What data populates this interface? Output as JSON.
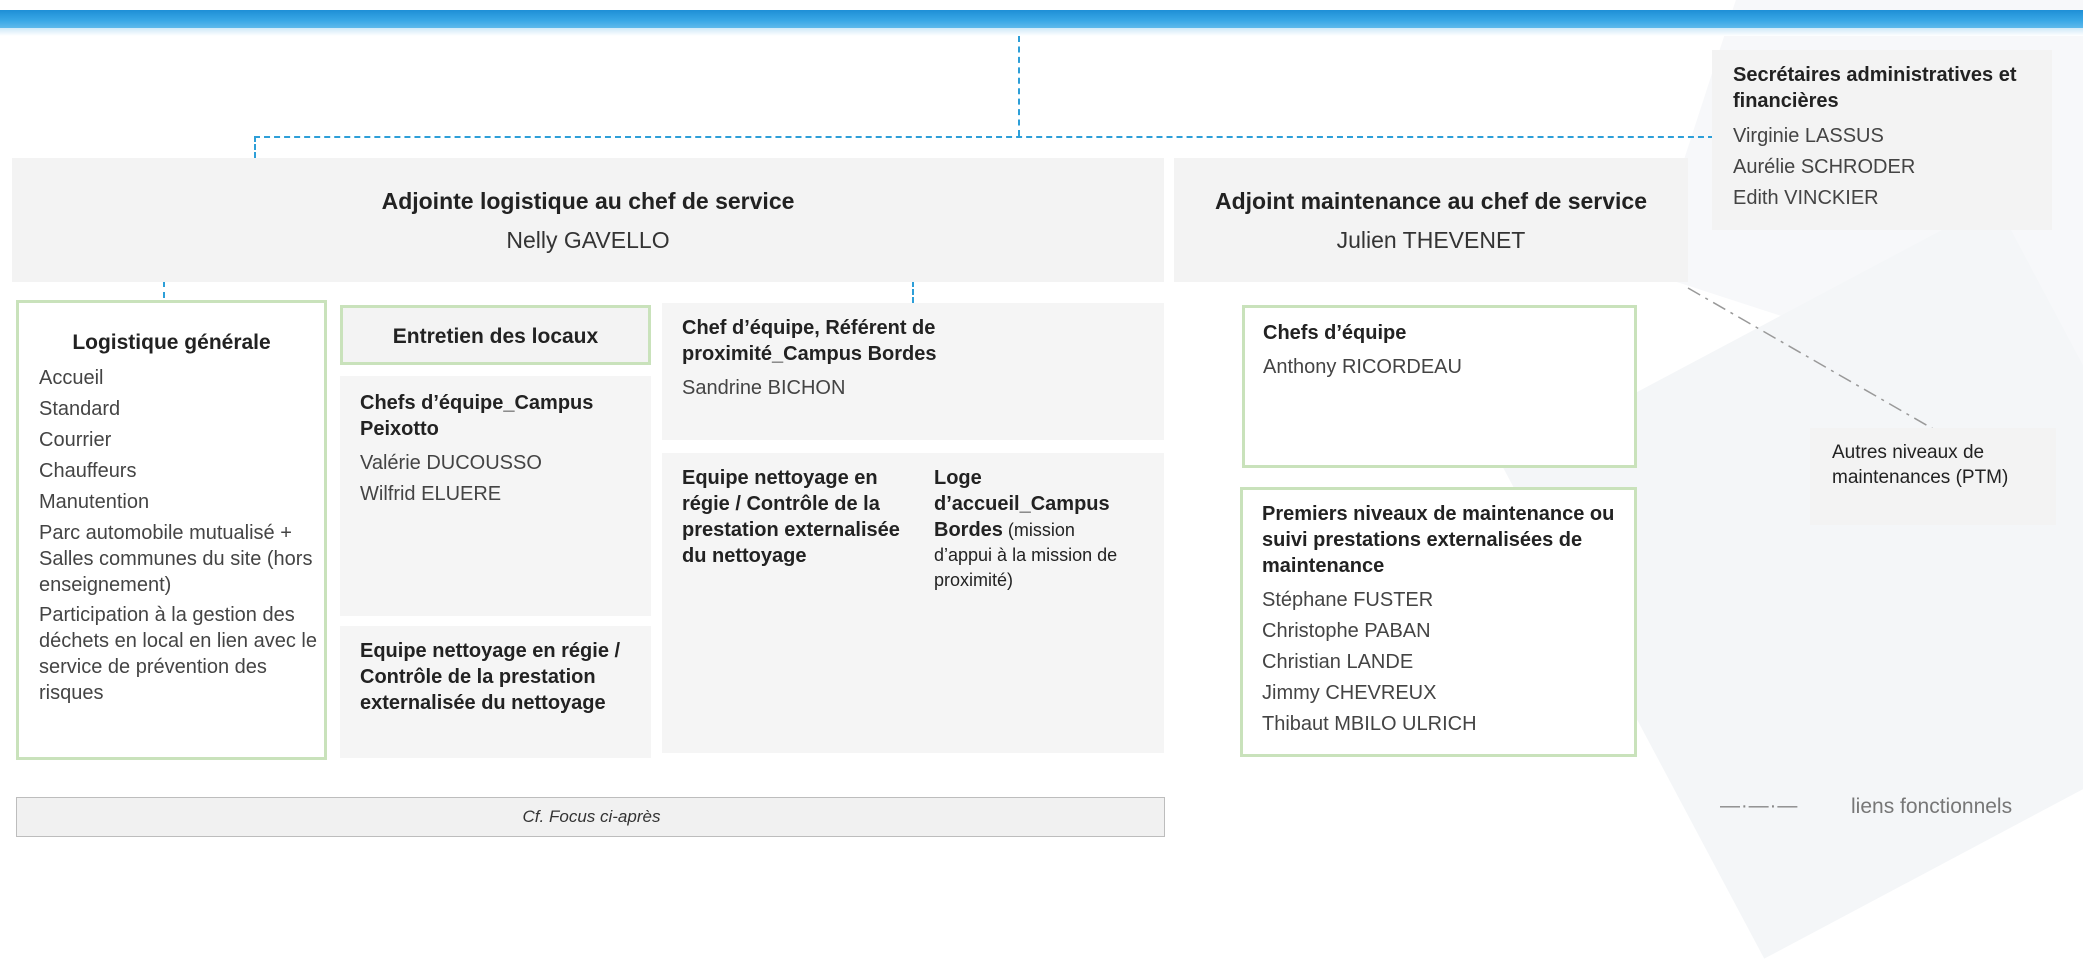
{
  "secretaires": {
    "title": "Secrétaires administratives et financières",
    "names": [
      "Virginie LASSUS",
      "Aurélie SCHRODER",
      "Edith VINCKIER"
    ]
  },
  "adjoint_logistique": {
    "title": "Adjointe logistique au chef de service",
    "name": "Nelly GAVELLO"
  },
  "adjoint_maintenance": {
    "title": "Adjoint maintenance au chef de service",
    "name": "Julien THEVENET"
  },
  "logistique_generale": {
    "title": "Logistique générale",
    "items": [
      "Accueil",
      "Standard",
      "Courrier",
      "Chauffeurs",
      "Manutention",
      "Parc automobile mutualisé + Salles communes du site (hors enseignement)",
      "Participation à la gestion des déchets en local en lien avec le service de prévention des risques"
    ]
  },
  "entretien": {
    "title": "Entretien des locaux"
  },
  "chefs_peixotto": {
    "title": "Chefs d’équipe_Campus Peixotto",
    "names": [
      "Valérie DUCOUSSO",
      "Wilfrid ELUERE"
    ]
  },
  "equipe_nettoyage_left": {
    "title": "Equipe nettoyage en régie / Contrôle de la prestation externalisée du nettoyage"
  },
  "chef_bordes": {
    "title": "Chef d’équipe, Référent  de proximité_Campus Bordes",
    "name": "Sandrine BICHON"
  },
  "equipe_nettoyage_mid": {
    "title": "Equipe nettoyage en régie / Contrôle de la prestation externalisée du nettoyage"
  },
  "loge": {
    "title": "Loge d’accueil_Campus Bordes",
    "rest": " (mission d’appui à la mission de proximité)"
  },
  "chefs_maintenance": {
    "title": "Chefs d’équipe",
    "names": [
      "Anthony RICORDEAU"
    ]
  },
  "premiers_niveaux": {
    "title": "Premiers niveaux de maintenance ou suivi prestations externalisées de maintenance",
    "names": [
      "Stéphane FUSTER",
      "Christophe PABAN",
      "Christian LANDE",
      "Jimmy CHEVREUX",
      "Thibaut MBILO ULRICH"
    ]
  },
  "autres_niveaux": {
    "text": "Autres niveaux de maintenances (PTM)"
  },
  "focus_note": "Cf. Focus ci-après",
  "legend": {
    "line_symbol": "—·—·—",
    "label": "liens fonctionnels"
  },
  "colors": {
    "blue_line": "#2d9fd8",
    "green_border": "#c9e2bb",
    "box_gray": "#f3f3f3"
  }
}
